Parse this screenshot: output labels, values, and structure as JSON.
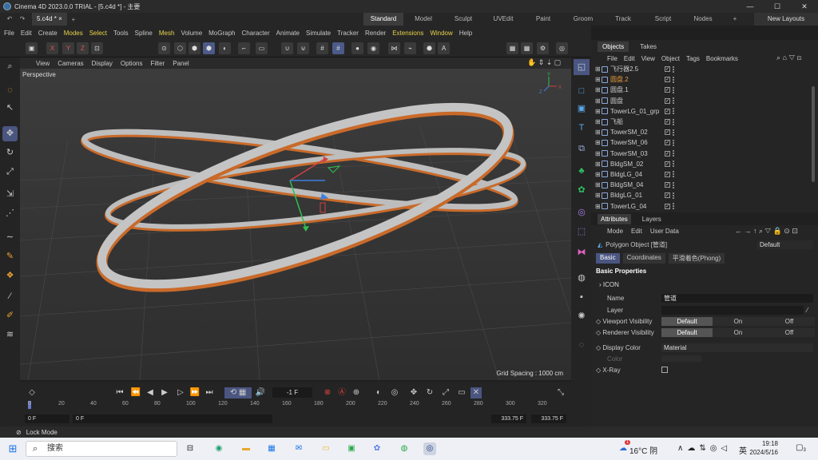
{
  "window": {
    "title": "Cinema 4D 2023.0.0 TRIAL - [5.c4d *] - 主要",
    "minimize": "—",
    "maximize": "☐",
    "close": "✕"
  },
  "tabs": {
    "document": "5.c4d *",
    "close": "×",
    "add": "+"
  },
  "layouts": [
    "Standard",
    "Model",
    "Sculpt",
    "UVEdit",
    "Paint",
    "Groom",
    "Track",
    "Script",
    "Nodes"
  ],
  "layout_add": "+",
  "new_layouts": "New Layouts",
  "menu": [
    "File",
    "Edit",
    "Create",
    "Modes",
    "Select",
    "Tools",
    "Spline",
    "Mesh",
    "Volume",
    "MoGraph",
    "Character",
    "Animate",
    "Simulate",
    "Tracker",
    "Render",
    "Extensions",
    "Window",
    "Help"
  ],
  "viewport_menu": [
    "View",
    "Cameras",
    "Display",
    "Options",
    "Filter",
    "Panel"
  ],
  "viewport": {
    "label": "Perspective",
    "grid_spacing": "Grid Spacing : 1000 cm"
  },
  "axis_labels": [
    "Y",
    "X",
    "Z"
  ],
  "timeline": {
    "ticks": [
      "0",
      "20",
      "40",
      "60",
      "80",
      "100",
      "120",
      "140",
      "160",
      "180",
      "200",
      "220",
      "240",
      "260",
      "280",
      "300",
      "320"
    ],
    "current_frame": "-1 F",
    "start_a": "0 F",
    "start_b": "0 F",
    "end_a": "333.75 F",
    "end_b": "333.75 F"
  },
  "panel_tabs": {
    "objects": "Objects",
    "takes": "Takes"
  },
  "objects_menu": [
    "File",
    "Edit",
    "View",
    "Object",
    "Tags",
    "Bookmarks"
  ],
  "objects": [
    {
      "name": "飞行器2.5",
      "selected": false
    },
    {
      "name": "圆盘.2",
      "selected": true
    },
    {
      "name": "圆盘.1",
      "selected": false
    },
    {
      "name": "圆盘",
      "selected": false
    },
    {
      "name": "TowerLG_01_grp",
      "selected": false
    },
    {
      "name": "飞船",
      "selected": false
    },
    {
      "name": "TowerSM_02",
      "selected": false
    },
    {
      "name": "TowerSM_06",
      "selected": false
    },
    {
      "name": "TowerSM_03",
      "selected": false
    },
    {
      "name": "BldgSM_02",
      "selected": false
    },
    {
      "name": "BldgLG_04",
      "selected": false
    },
    {
      "name": "BldgSM_04",
      "selected": false
    },
    {
      "name": "BldgLG_01",
      "selected": false
    },
    {
      "name": "TowerLG_04",
      "selected": false
    }
  ],
  "attr_tabs": {
    "attributes": "Attributes",
    "layers": "Layers"
  },
  "attr_menu": [
    "Mode",
    "Edit",
    "User Data"
  ],
  "attr": {
    "object_type": "Polygon Object [管道]",
    "preset": "Default",
    "tabs": [
      "Basic",
      "Coordinates",
      "平滑着色(Phong)"
    ],
    "section": "Basic Properties",
    "group": "ICON",
    "name_label": "Name",
    "name_value": "管道",
    "layer_label": "Layer",
    "viewport_vis_label": "Viewport Visibility",
    "renderer_vis_label": "Renderer Visibility",
    "vis_options": [
      "Default",
      "On",
      "Off"
    ],
    "display_color_label": "Display Color",
    "display_color_value": "Material",
    "color_label": "Color",
    "xray_label": "X-Ray"
  },
  "status": {
    "lock_mode": "Lock Mode"
  },
  "taskbar": {
    "search": "搜索",
    "weather": "16°C 阴",
    "lang": "英",
    "time": "19:18",
    "date": "2024/5/16",
    "weather_badge": "1",
    "notif_badge": "3"
  },
  "colors": {
    "accent": "#4a5580",
    "selected_object": "#e69a3a",
    "highlight_menu": "#e8d24a",
    "ring_orange": "#c96a2a",
    "ring_surface": "#bdbdbd"
  }
}
